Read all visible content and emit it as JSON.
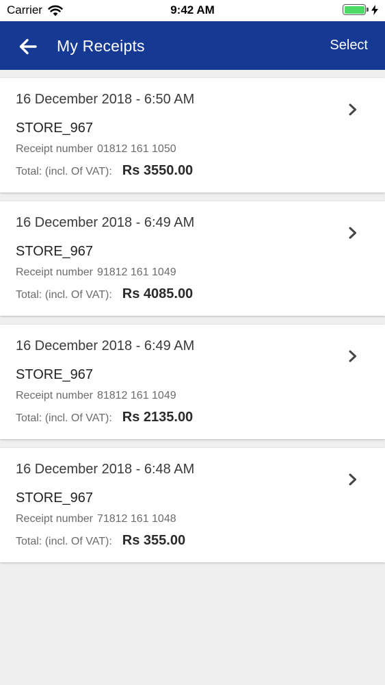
{
  "status_bar": {
    "carrier": "Carrier",
    "time": "9:42 AM",
    "battery_level": 1.0,
    "battery_color": "#4cd964"
  },
  "header": {
    "back_icon": "arrow-left-icon",
    "title": "My Receipts",
    "action_label": "Select",
    "background_color": "#163a94"
  },
  "receipts": [
    {
      "date": "16 December 2018 - 6:50 AM",
      "store": "STORE_967",
      "receipt_label": "Receipt number",
      "receipt_number": "01812 161 1050",
      "total_label": "Total: (incl. Of VAT):",
      "total": "Rs 3550.00"
    },
    {
      "date": "16 December 2018 - 6:49 AM",
      "store": "STORE_967",
      "receipt_label": "Receipt number",
      "receipt_number": "91812 161 1049",
      "total_label": "Total: (incl. Of VAT):",
      "total": "Rs 4085.00"
    },
    {
      "date": "16 December 2018 - 6:49 AM",
      "store": "STORE_967",
      "receipt_label": "Receipt number",
      "receipt_number": "81812 161 1049",
      "total_label": "Total: (incl. Of VAT):",
      "total": "Rs 2135.00"
    },
    {
      "date": "16 December 2018 - 6:48 AM",
      "store": "STORE_967",
      "receipt_label": "Receipt number",
      "receipt_number": "71812 161 1048",
      "total_label": "Total: (incl. Of VAT):",
      "total": "Rs 355.00"
    }
  ]
}
